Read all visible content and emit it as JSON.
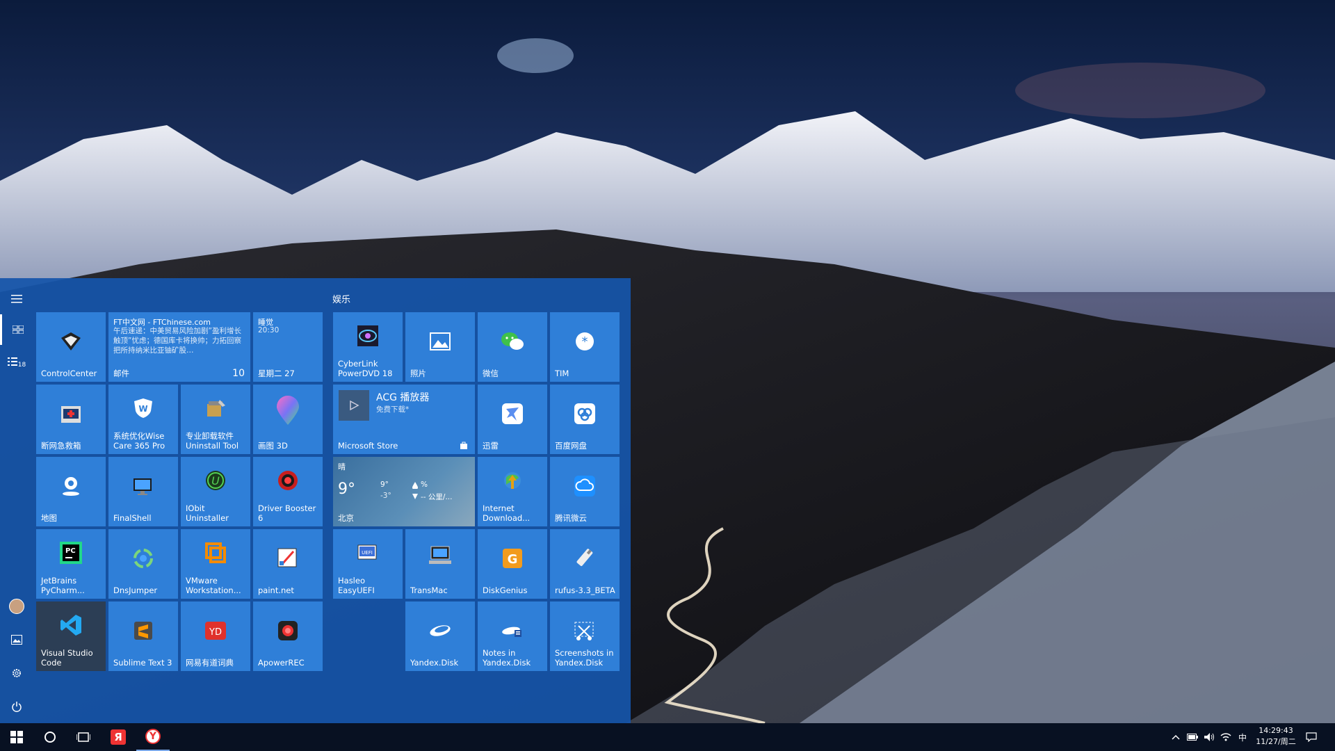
{
  "group_entertainment": "娱乐",
  "tiles": {
    "controlcenter": "ControlCenter",
    "mail": {
      "sender": "FT中文网 - FTChinese.com",
      "body": "午后速递：中美贸易风险加剧”盈利增长触顶”忧虑；德国库卡将换帅；力拓回察把所持纳米比亚铀矿股…",
      "app": "邮件",
      "count": "10"
    },
    "calendar": {
      "event": "睡觉",
      "time": "20:30",
      "date": "星期二 27"
    },
    "cyberlink": "CyberLink PowerDVD 18",
    "photos": "照片",
    "wechat": "微信",
    "tim": "TIM",
    "emergency": "断网急救箱",
    "wisecare": "系统优化Wise Care 365 Pro",
    "uninstall": "专业卸载软件 Uninstall Tool",
    "paint3d": "画图 3D",
    "store": {
      "app_title": "ACG 播放器",
      "subtitle": "免费下载*",
      "label": "Microsoft Store"
    },
    "xunlei": "迅雷",
    "baidu": "百度网盘",
    "maps": "地图",
    "finalshell": "FinalShell",
    "iobit": "IObit Uninstaller",
    "driverbooster": "Driver Booster 6",
    "weather": {
      "condition": "晴",
      "temp": "9°",
      "high": "9°",
      "low": "-3°",
      "humidity": "%",
      "wind": "-- 公里/...",
      "city": "北京"
    },
    "idm": "Internet Download...",
    "weiyun": "腾讯微云",
    "pycharm": "JetBrains PyCharm...",
    "dnsjumper": "DnsJumper",
    "vmware": "VMware Workstation...",
    "paintnet": "paint.net",
    "easyuefi": "Hasleo EasyUEFI",
    "transmac": "TransMac",
    "diskgenius": "DiskGenius",
    "rufus": "rufus-3.3_BETA",
    "vscode": "Visual Studio Code",
    "sublime": "Sublime Text 3",
    "youdao": "网易有道词典",
    "apowerrec": "ApowerREC",
    "yandexdisk": "Yandex.Disk",
    "notesyandex": "Notes in Yandex.Disk",
    "screenshotsyandex": "Screenshots in Yandex.Disk"
  },
  "rail": {
    "badge": "18"
  },
  "taskbar": {
    "yandex_letter": "Я",
    "yandex_browser_letter": "Y"
  },
  "tray": {
    "ime": "中",
    "time": "14:29:43",
    "date": "11/27/周二"
  },
  "colors": {
    "tile": "#2f7fd8",
    "menu": "#1655aa",
    "taskbar": "#081022"
  }
}
